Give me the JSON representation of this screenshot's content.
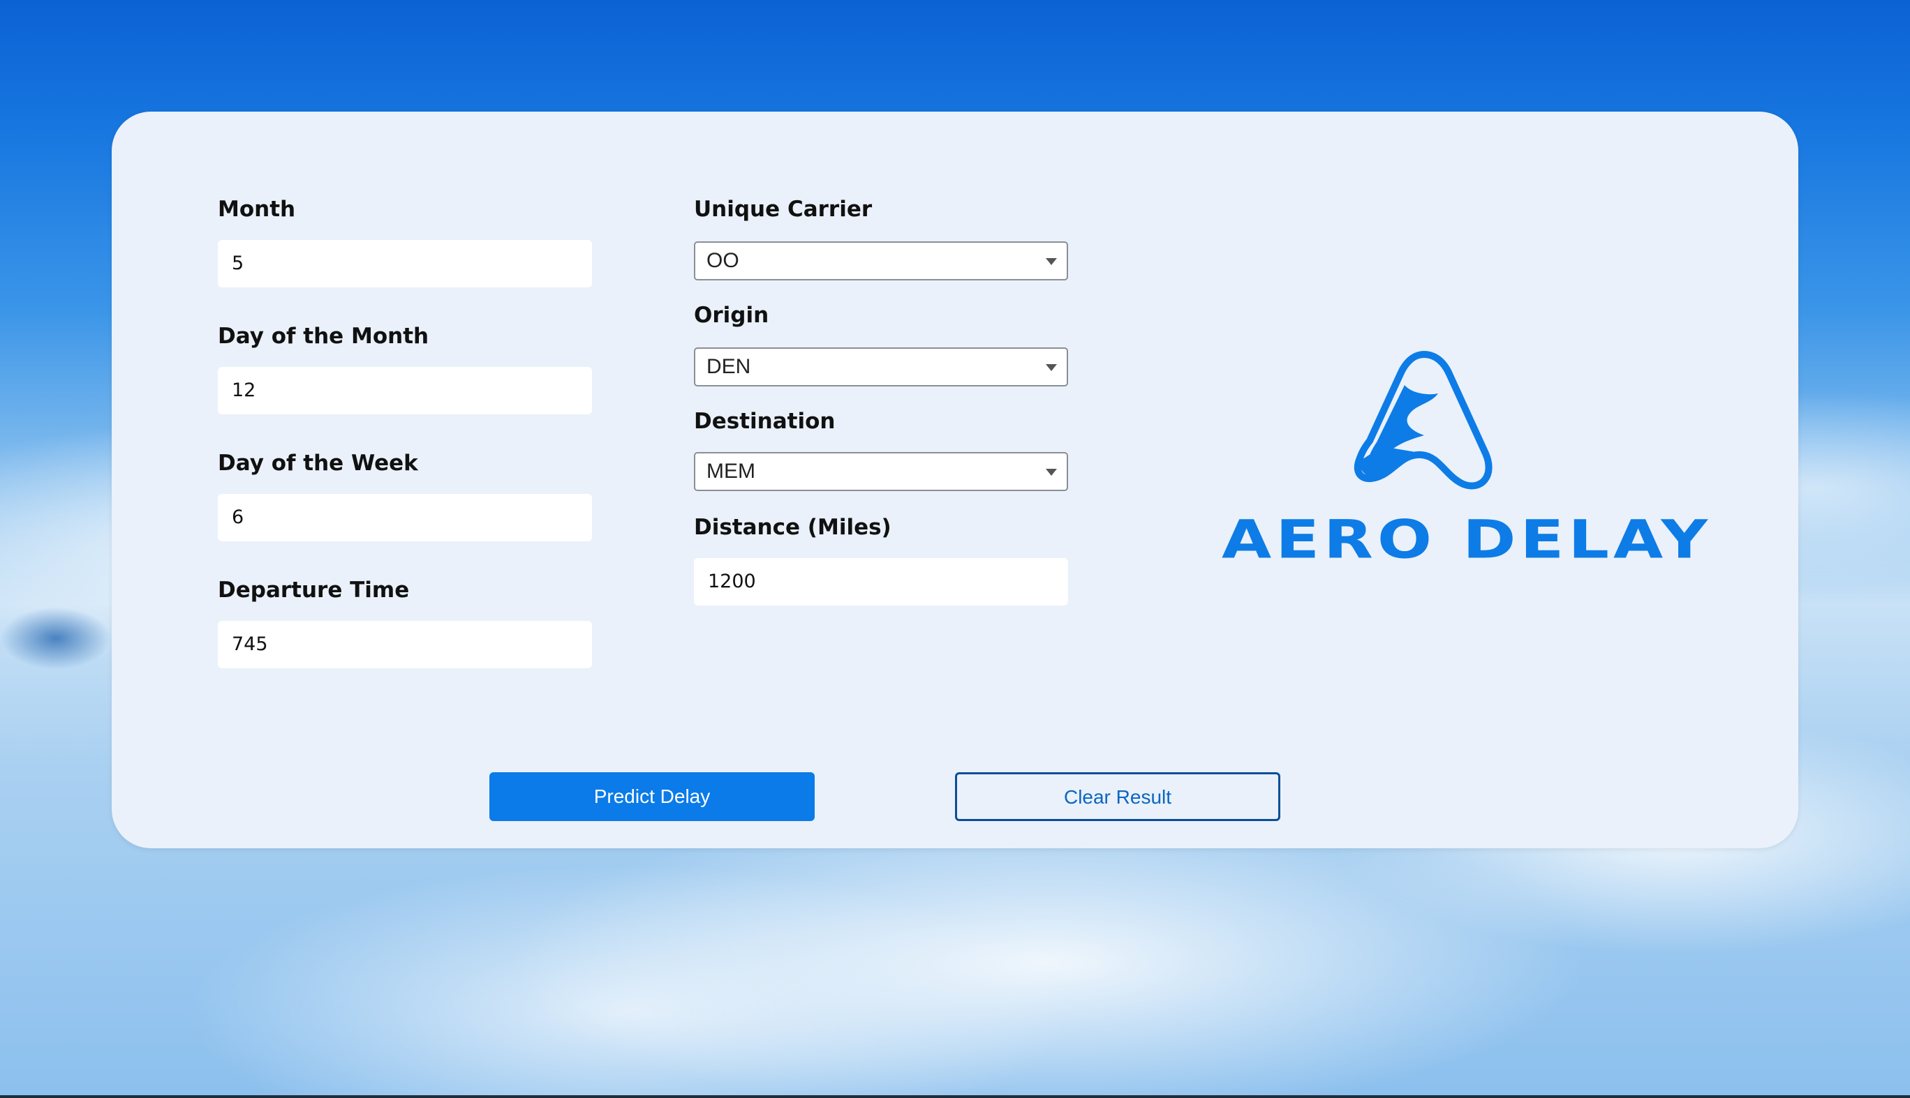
{
  "form": {
    "month": {
      "label": "Month",
      "value": "5"
    },
    "day_of_month": {
      "label": "Day of the Month",
      "value": "12"
    },
    "day_of_week": {
      "label": "Day of the Week",
      "value": "6"
    },
    "departure_time": {
      "label": "Departure Time",
      "value": "745"
    },
    "unique_carrier": {
      "label": "Unique Carrier",
      "value": "OO"
    },
    "origin": {
      "label": "Origin",
      "value": "DEN"
    },
    "destination": {
      "label": "Destination",
      "value": "MEM"
    },
    "distance": {
      "label": "Distance (Miles)",
      "value": "1200"
    }
  },
  "actions": {
    "predict_label": "Predict Delay",
    "clear_label": "Clear Result"
  },
  "logo": {
    "text": "AERO DELAY",
    "color": "#0d7ce6"
  },
  "colors": {
    "primary": "#0a7be8",
    "card_background": "#eaf1fa"
  }
}
